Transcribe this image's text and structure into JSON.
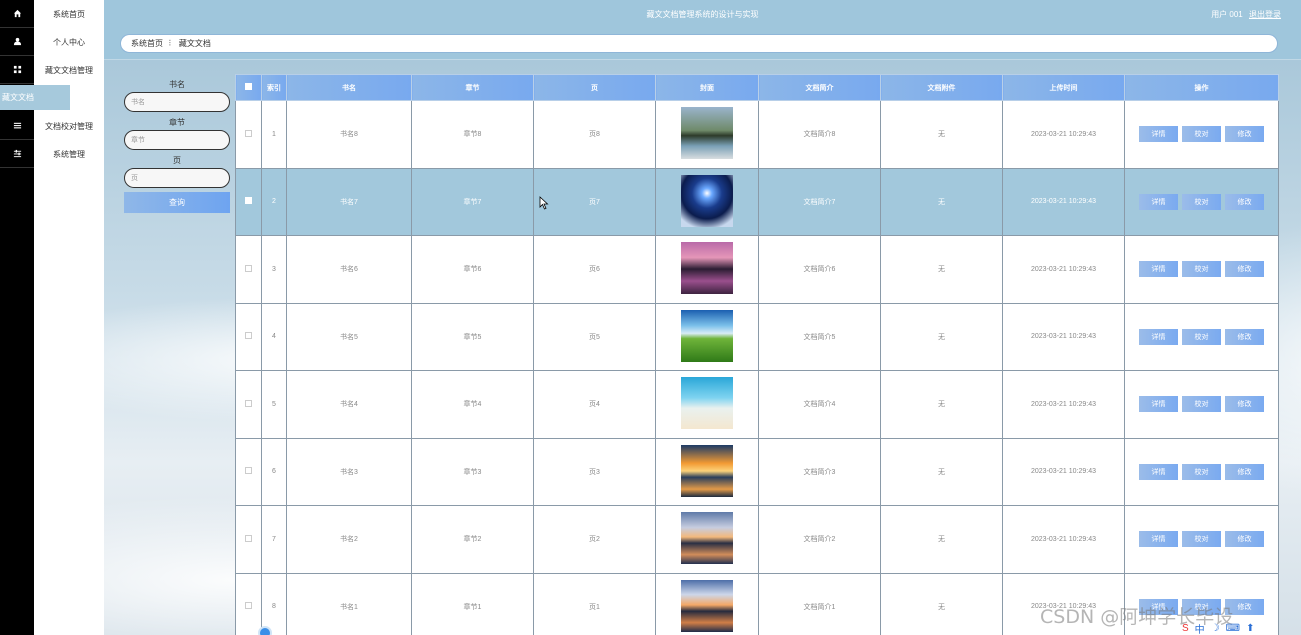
{
  "app": {
    "title": "藏文文档管理系统的设计与实现",
    "user_label": "用户 001",
    "logout_label": "退出登录"
  },
  "rail_icons": [
    "home-icon",
    "user-icon",
    "grid-icon",
    "list-icon",
    "settings-icon"
  ],
  "sidebar": {
    "items": [
      {
        "label": "系统首页"
      },
      {
        "label": "个人中心"
      },
      {
        "label": "藏文文档管理"
      },
      {
        "label": "文档校对管理"
      },
      {
        "label": "系统管理"
      }
    ],
    "active_sub": "藏文文档"
  },
  "breadcrumb": {
    "home": "系统首页",
    "sep": "⠇",
    "current": "藏文文档"
  },
  "search": {
    "book_label": "书名",
    "book_placeholder": "书名",
    "chapter_label": "章节",
    "chapter_placeholder": "章节",
    "page_label": "页",
    "page_placeholder": "页",
    "button": "查询"
  },
  "table": {
    "headers": [
      "索引",
      "书名",
      "章节",
      "页",
      "封面",
      "文档简介",
      "文档附件",
      "上传时间",
      "操作"
    ],
    "actions": [
      "详情",
      "校对",
      "修改"
    ],
    "rows": [
      {
        "idx": "1",
        "book": "书名8",
        "chapter": "章节8",
        "page": "页8",
        "intro": "文档简介8",
        "attach": "无",
        "time": "2023-03-21 10:29:43",
        "cover": "mountain-lake"
      },
      {
        "idx": "2",
        "book": "书名7",
        "chapter": "章节7",
        "page": "页7",
        "intro": "文档简介7",
        "attach": "无",
        "time": "2023-03-21 10:29:43",
        "cover": "night-mountain"
      },
      {
        "idx": "3",
        "book": "书名6",
        "chapter": "章节6",
        "page": "页6",
        "intro": "文档简介6",
        "attach": "无",
        "time": "2023-03-21 10:29:43",
        "cover": "sunset-lake"
      },
      {
        "idx": "4",
        "book": "书名5",
        "chapter": "章节5",
        "page": "页5",
        "intro": "文档简介5",
        "attach": "无",
        "time": "2023-03-21 10:29:43",
        "cover": "green-field"
      },
      {
        "idx": "5",
        "book": "书名4",
        "chapter": "章节4",
        "page": "页4",
        "intro": "文档简介4",
        "attach": "无",
        "time": "2023-03-21 10:29:43",
        "cover": "beach"
      },
      {
        "idx": "6",
        "book": "书名3",
        "chapter": "章节3",
        "page": "页3",
        "intro": "文档简介3",
        "attach": "无",
        "time": "2023-03-21 10:29:43",
        "cover": "orange-sunset"
      },
      {
        "idx": "7",
        "book": "书名2",
        "chapter": "章节2",
        "page": "页2",
        "intro": "文档简介2",
        "attach": "无",
        "time": "2023-03-21 10:29:43",
        "cover": "pier-sunset"
      },
      {
        "idx": "8",
        "book": "书名1",
        "chapter": "章节1",
        "page": "页1",
        "intro": "文档简介1",
        "attach": "无",
        "time": "2023-03-21 10:29:43",
        "cover": "pier-sunset-2"
      }
    ],
    "selected_row": 1
  },
  "watermark": "CSDN @阿坤学长毕设"
}
